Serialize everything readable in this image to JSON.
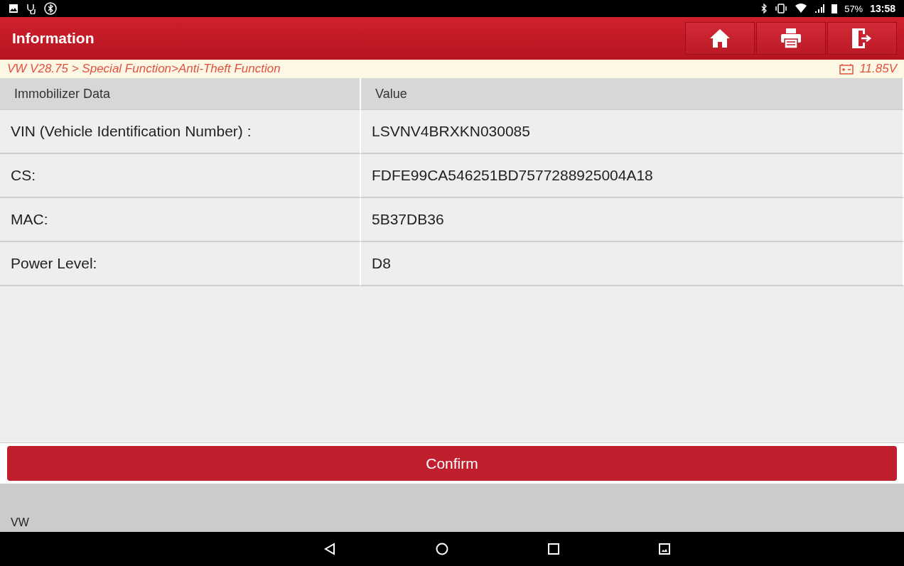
{
  "status_bar": {
    "battery": "57%",
    "time": "13:58"
  },
  "header": {
    "title": "Information"
  },
  "breadcrumb": {
    "path": "VW V28.75 > Special Function>Anti-Theft Function",
    "voltage": "11.85V"
  },
  "table": {
    "columns": [
      "Immobilizer Data",
      "Value"
    ],
    "rows": [
      {
        "label": "VIN (Vehicle Identification Number) :",
        "value": "LSVNV4BRXKN030085"
      },
      {
        "label": "CS:",
        "value": "FDFE99CA546251BD7577288925004A18"
      },
      {
        "label": "MAC:",
        "value": "5B37DB36"
      },
      {
        "label": "Power Level:",
        "value": "D8"
      }
    ]
  },
  "confirm_button": "Confirm",
  "footer": {
    "vehicle": "VW"
  }
}
